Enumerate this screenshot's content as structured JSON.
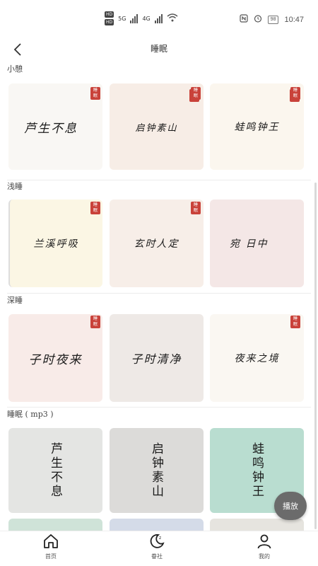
{
  "status_bar": {
    "hd1": "HD",
    "hd2": "HD",
    "net1": "5G",
    "net2": "4G",
    "wifi": "6",
    "battery": "98",
    "time": "10:47"
  },
  "header": {
    "title": "睡眠"
  },
  "sections": [
    {
      "label": "小憩",
      "cards": [
        {
          "text": "芦生不息",
          "bg": "#f9f7f4"
        },
        {
          "text": "启钟素山",
          "bg": "#f7ede6"
        },
        {
          "text": "蛙鸣钟王",
          "bg": "#fbf6ee"
        }
      ]
    },
    {
      "label": "浅睡",
      "cards": [
        {
          "text": "兰溪呼吸",
          "bg": "#fbf6e4"
        },
        {
          "text": "玄时人定",
          "bg": "#f7eee8"
        },
        {
          "text": "宛 日中",
          "bg": "#f4e7e6"
        }
      ]
    },
    {
      "label": "深睡",
      "cards": [
        {
          "text": "子时夜来",
          "bg": "#f8ebe8"
        },
        {
          "text": "子时清净",
          "bg": "#eee9e6"
        },
        {
          "text": "夜来之境",
          "bg": "#faf7f2"
        }
      ]
    },
    {
      "label": "睡眠 ( mp3 )",
      "cards": [
        {
          "text": "芦生不息",
          "bg": "#e4e5e3"
        },
        {
          "text": "启钟素山",
          "bg": "#dcdbd9"
        },
        {
          "text": "蛙鸣钟王",
          "bg": "#b9ddd0"
        }
      ]
    }
  ],
  "seal_text": "睡眠",
  "play_button": "播放",
  "tabs": [
    {
      "label": "首页",
      "icon": "home-icon"
    },
    {
      "label": "眷社",
      "icon": "moon-icon"
    },
    {
      "label": "我的",
      "icon": "user-icon"
    }
  ],
  "colors": {
    "seal": "#c9423a",
    "play_button": "#6b6b6b"
  }
}
